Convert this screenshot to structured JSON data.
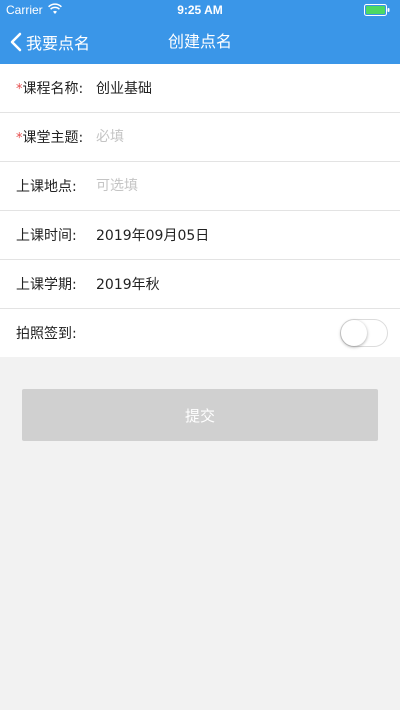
{
  "status_bar": {
    "carrier": "Carrier",
    "time": "9:25 AM",
    "battery_color": "#4cd964"
  },
  "nav": {
    "back_label": "我要点名",
    "title": "创建点名",
    "bar_color": "#3a96e8"
  },
  "form": {
    "course_name": {
      "required_mark": "*",
      "label": "课程名称:",
      "value": "创业基础"
    },
    "class_topic": {
      "required_mark": "*",
      "label": "课堂主题:",
      "placeholder": "必填",
      "value": ""
    },
    "location": {
      "label": "上课地点:",
      "placeholder": "可选填",
      "value": ""
    },
    "class_time": {
      "label": "上课时间:",
      "value": "2019年09月05日"
    },
    "semester": {
      "label": "上课学期:",
      "value": "2019年秋"
    },
    "photo_checkin": {
      "label": "拍照签到:",
      "enabled": false
    }
  },
  "submit_label": "提交"
}
